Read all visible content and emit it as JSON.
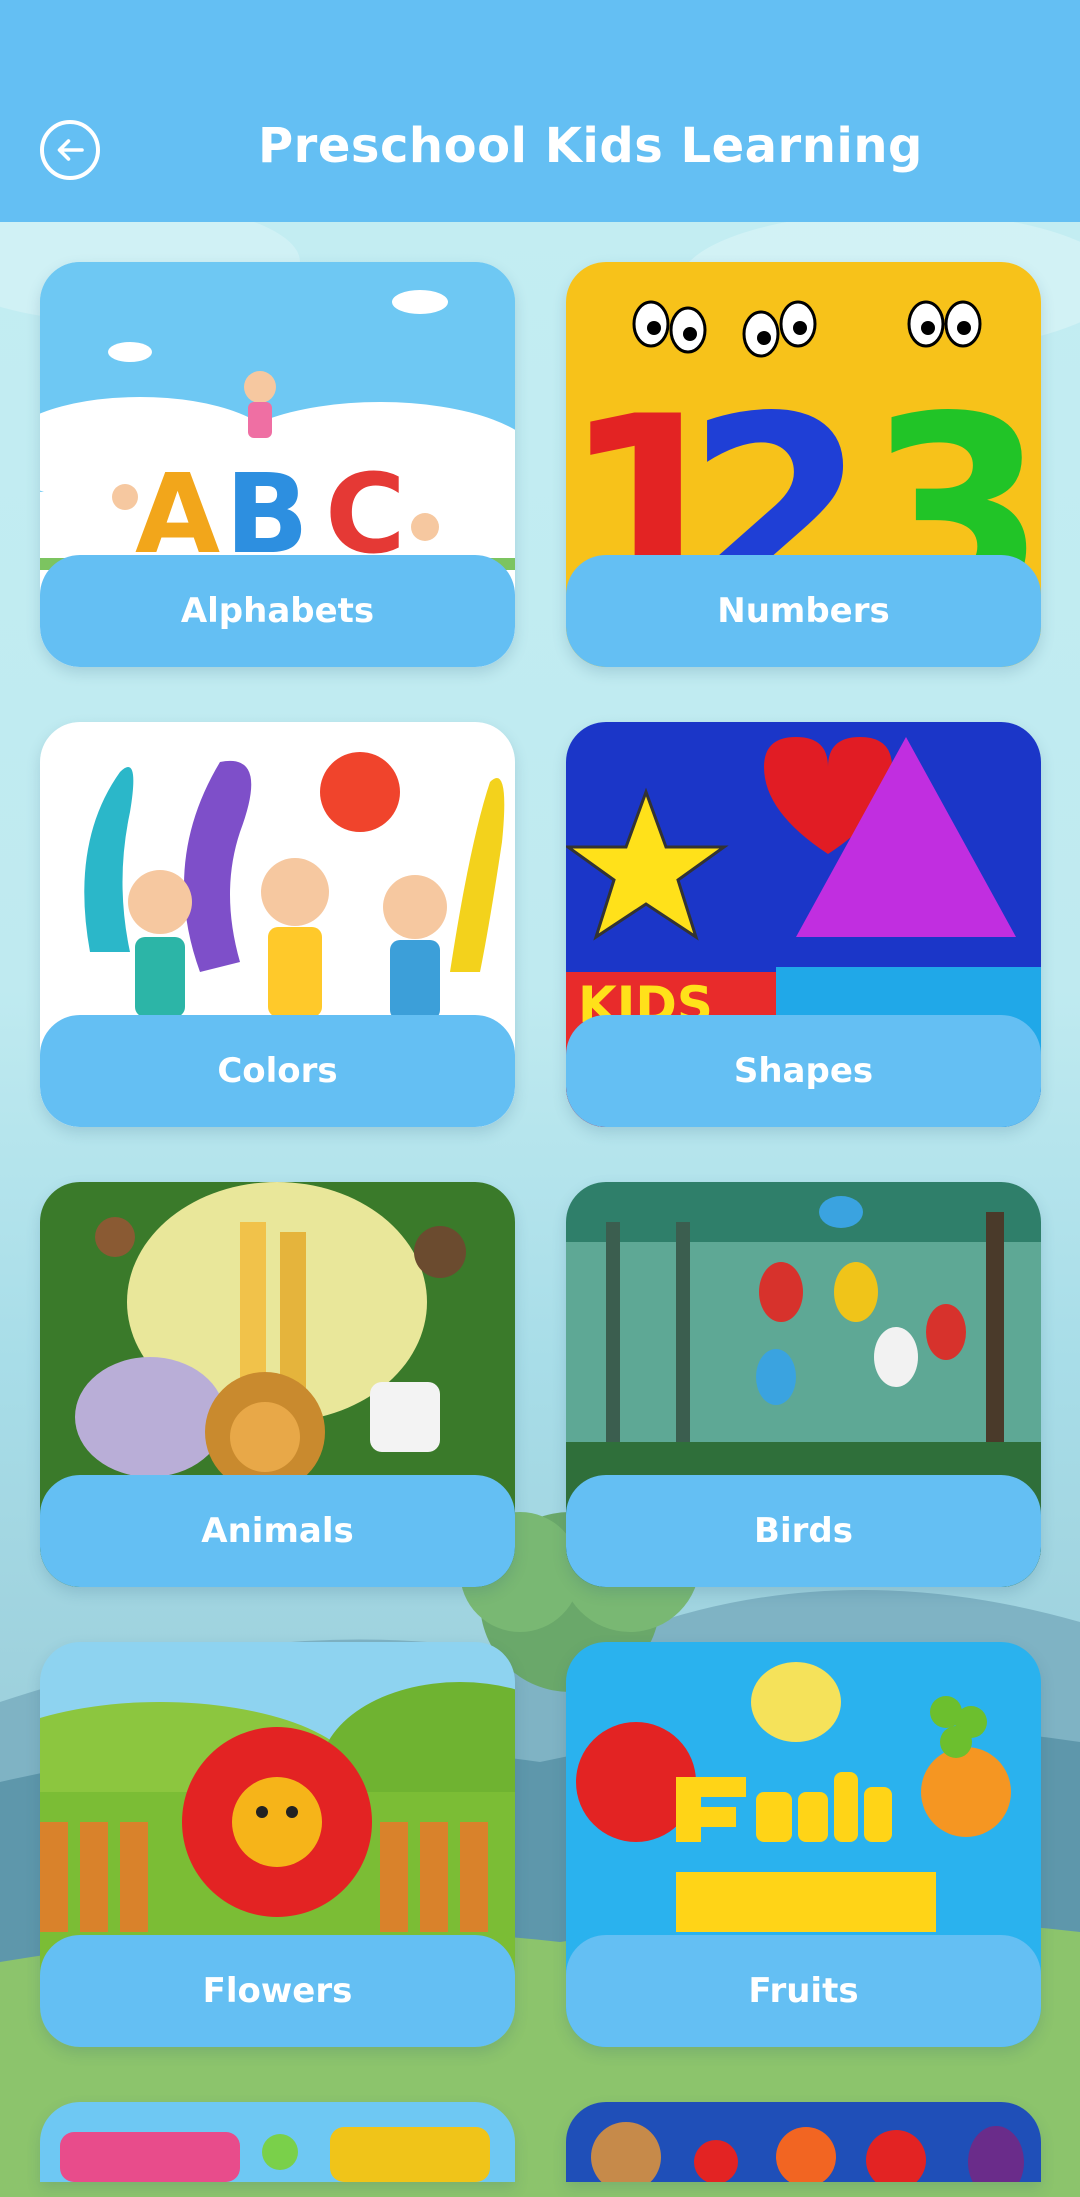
{
  "app_bar": {
    "title": "Preschool Kids Learning",
    "back_icon": "arrow-left-circle-icon",
    "color": "#64bff3"
  },
  "categories": [
    {
      "label": "Alphabets",
      "thumbnail": "abc-letters-kids-illustration"
    },
    {
      "label": "Numbers",
      "thumbnail": "123-cartoon-numbers-illustration"
    },
    {
      "label": "Colors",
      "thumbnail": "kids-painting-splashes-illustration"
    },
    {
      "label": "Shapes",
      "thumbnail": "star-heart-triangle-shapes-illustration"
    },
    {
      "label": "Animals",
      "thumbnail": "jungle-animals-illustration"
    },
    {
      "label": "Birds",
      "thumbnail": "parrots-in-forest-illustration"
    },
    {
      "label": "Flowers",
      "thumbnail": "smiling-red-flower-illustration"
    },
    {
      "label": "Fruits",
      "thumbnail": "fruits-name-illustration"
    },
    {
      "label": "",
      "thumbnail": "months-of-year-illustration"
    },
    {
      "label": "",
      "thumbnail": "vegetables-illustration"
    }
  ],
  "colors": {
    "accent": "#64bff3",
    "label_text": "#ffffff"
  }
}
